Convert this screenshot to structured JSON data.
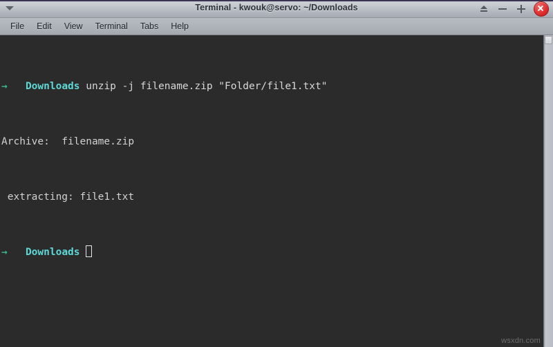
{
  "window": {
    "title": "Terminal - kwouk@servo: ~/Downloads",
    "dropdown_icon": "chevron-down-icon",
    "controls": {
      "shade": "shade-window-icon",
      "minimize": "minimize-icon",
      "maximize": "maximize-icon",
      "close": "close-icon"
    }
  },
  "menubar": {
    "items": [
      {
        "label": "File"
      },
      {
        "label": "Edit"
      },
      {
        "label": "View"
      },
      {
        "label": "Terminal"
      },
      {
        "label": "Tabs"
      },
      {
        "label": "Help"
      }
    ]
  },
  "terminal": {
    "prompt_symbol": "→",
    "prompt_dir": "Downloads",
    "colors": {
      "background": "#2b2b2b",
      "foreground": "#d6d6d6",
      "prompt_arrow": "#39b88a",
      "prompt_dir": "#5fd7d7"
    },
    "lines": [
      {
        "type": "prompt",
        "arrow": "→",
        "dir": "Downloads",
        "command": "unzip -j filename.zip \"Folder/file1.txt\""
      },
      {
        "type": "output",
        "text": "Archive:  filename.zip"
      },
      {
        "type": "output",
        "text": " extracting: file1.txt"
      },
      {
        "type": "prompt-cursor",
        "arrow": "→",
        "dir": "Downloads",
        "command": ""
      }
    ]
  },
  "scrollbar": {
    "orientation": "vertical",
    "thumb_position_percent": 0
  },
  "watermark": {
    "text": "wsxdn.com"
  }
}
